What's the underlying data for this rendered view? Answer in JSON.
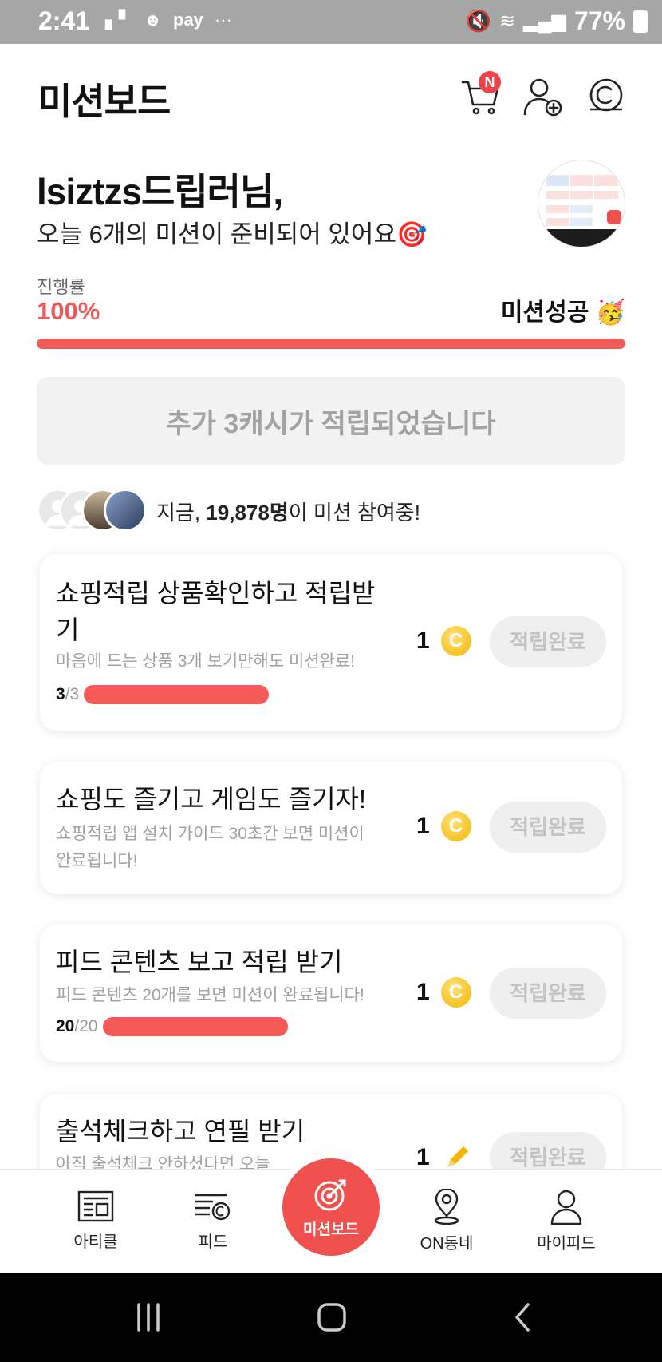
{
  "status_bar": {
    "time": "2:41",
    "pay_label": "pay",
    "more": "···",
    "battery": "77%"
  },
  "header": {
    "title": "미션보드",
    "cart_badge": "N"
  },
  "greeting": {
    "name_line": "lsiztzs드립러님,",
    "sub_line": "오늘 6개의 미션이 준비되어 있어요🎯"
  },
  "progress": {
    "label": "진행률",
    "value_text": "100%",
    "fraction": 1.0,
    "success_label": "미션성공 🥳"
  },
  "notice": {
    "text": "추가 3캐시가 적립되었습니다"
  },
  "participants": {
    "prefix": "지금, ",
    "count": "19,878명",
    "suffix": "이 미션 참여중!"
  },
  "missions": [
    {
      "title": "쇼핑적립 상품확인하고 적립받기",
      "desc": "마음에 드는 상품 3개 보기만해도 미션완료!",
      "progress_done": "3",
      "progress_total": "/3",
      "progress_fraction": 1.0,
      "reward": "1",
      "reward_icon": "coin-icon",
      "button": "적립완료"
    },
    {
      "title": "쇼핑도 즐기고 게임도 즐기자!",
      "desc": "쇼핑적립 앱 설치 가이드 30초간 보면 미션이 완료됩니다!",
      "reward": "1",
      "reward_icon": "coin-icon",
      "button": "적립완료"
    },
    {
      "title": "피드 콘텐츠 보고 적립 받기",
      "desc": "피드 콘텐츠 20개를 보면 미션이 완료됩니다!",
      "progress_done": "20",
      "progress_total": "/20",
      "progress_fraction": 1.0,
      "reward": "1",
      "reward_icon": "coin-icon",
      "button": "적립완료"
    },
    {
      "title": "출석체크하고 연필 받기",
      "desc": "아직 출석체크 안하셨다면 오늘",
      "reward": "1",
      "reward_icon": "pencil-icon",
      "button": "적립완료"
    }
  ],
  "bottom_nav": {
    "article": "아티클",
    "feed": "피드",
    "missionboard": "미션보드",
    "on_dongne": "ON동네",
    "mypeed": "마이피드"
  },
  "colors": {
    "accent": "#f65a58",
    "progress_text": "#f0595a",
    "badge": "#f0424a",
    "coin": "#f4b400"
  }
}
